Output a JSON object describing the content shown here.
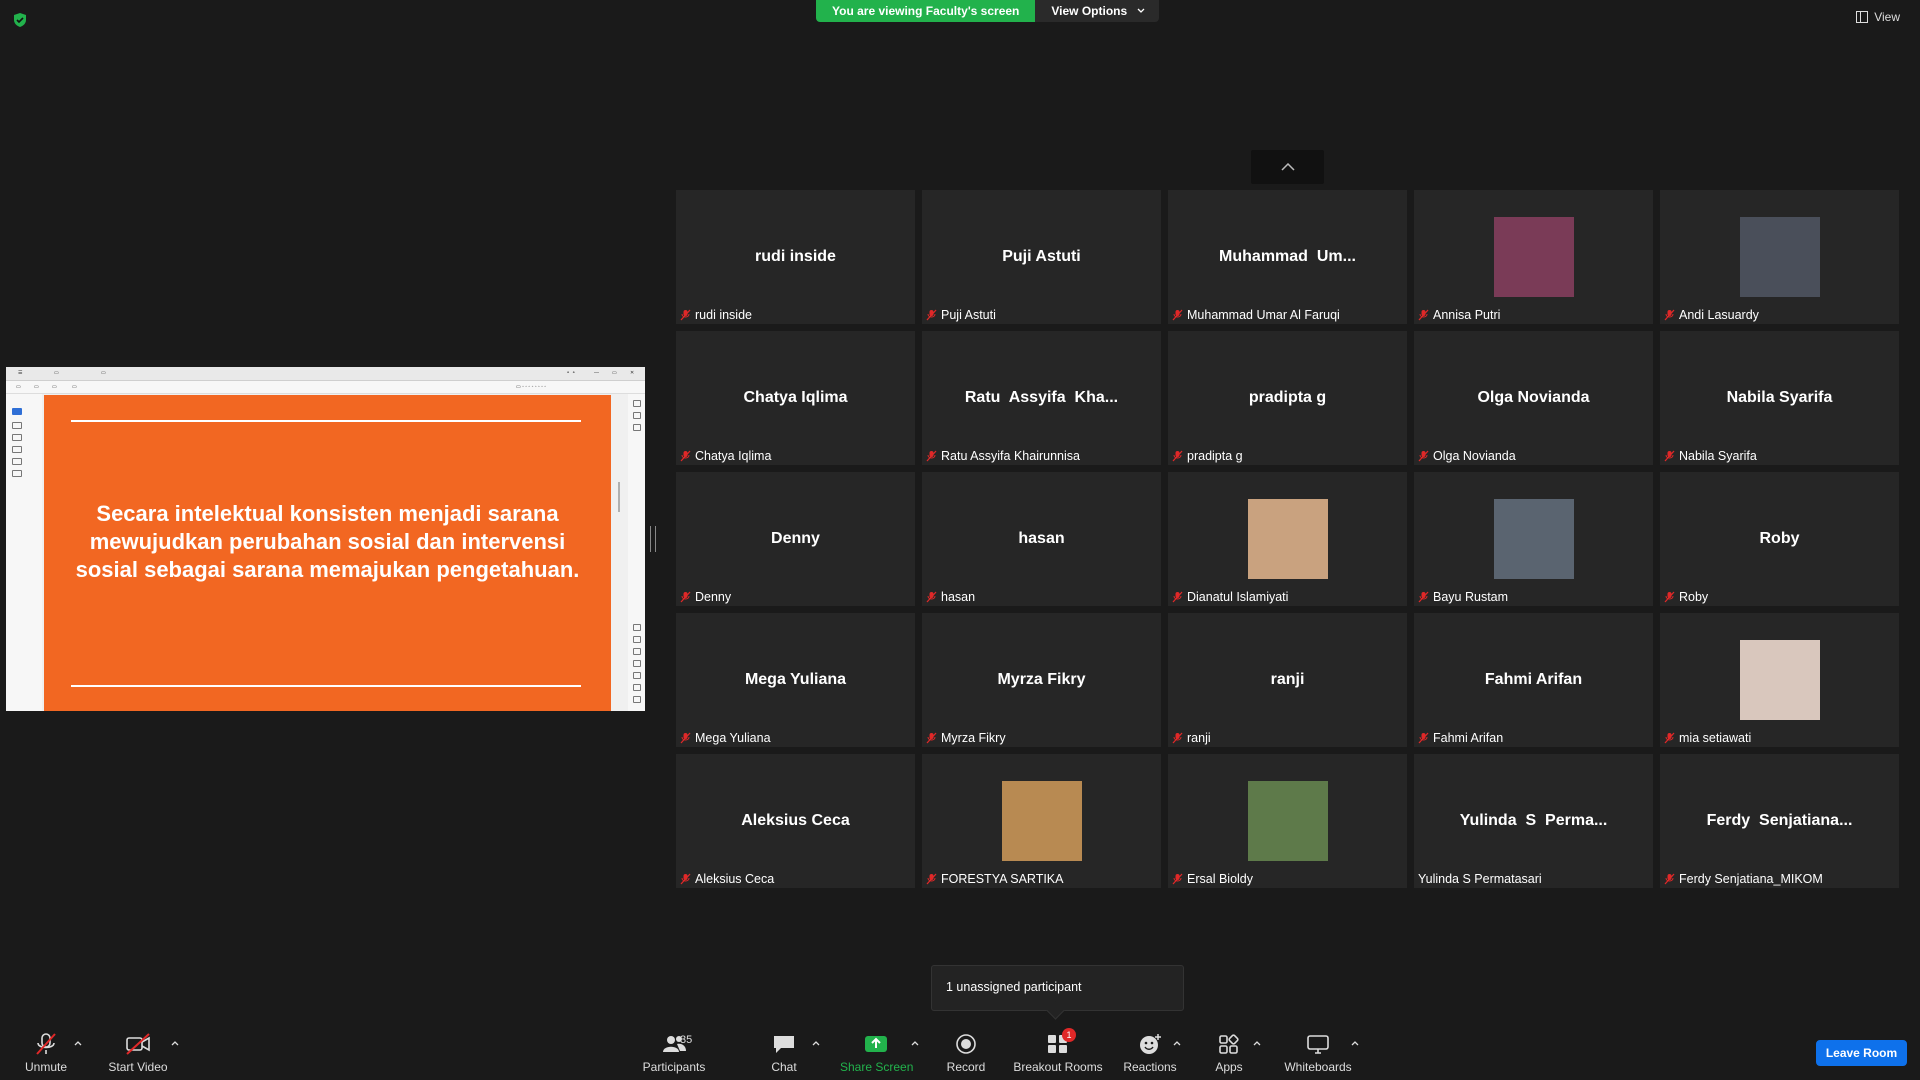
{
  "banner": {
    "viewing": "You are viewing Faculty's screen",
    "view_options": "View Options"
  },
  "top_view": {
    "label": "View"
  },
  "shared_screen": {
    "slide_text": "Secara intelektual konsisten menjadi sarana mewujudkan perubahan sosial dan intervensi sosial sebagai sarana memajukan pengetahuan.",
    "slide_color": "#f26722"
  },
  "participants": [
    {
      "display": "rudi inside",
      "name": "rudi inside",
      "muted": true,
      "photo": false
    },
    {
      "display": "Puji Astuti",
      "name": "Puji Astuti",
      "muted": true,
      "photo": false
    },
    {
      "display": "Muhammad  Um...",
      "name": "Muhammad Umar Al Faruqi",
      "muted": true,
      "photo": false
    },
    {
      "display": "",
      "name": "Annisa Putri",
      "muted": true,
      "photo": true,
      "photo_color": "#7a3b57"
    },
    {
      "display": "",
      "name": "Andi Lasuardy",
      "muted": true,
      "photo": true,
      "photo_color": "#4a4f5a"
    },
    {
      "display": "Chatya Iqlima",
      "name": "Chatya Iqlima",
      "muted": true,
      "photo": false
    },
    {
      "display": "Ratu  Assyifa  Kha...",
      "name": "Ratu Assyifa Khairunnisa",
      "muted": true,
      "photo": false
    },
    {
      "display": "pradipta g",
      "name": "pradipta g",
      "muted": true,
      "photo": false
    },
    {
      "display": "Olga Novianda",
      "name": "Olga Novianda",
      "muted": true,
      "photo": false
    },
    {
      "display": "Nabila Syarifa",
      "name": "Nabila Syarifa",
      "muted": true,
      "photo": false
    },
    {
      "display": "Denny",
      "name": "Denny",
      "muted": true,
      "photo": false
    },
    {
      "display": "hasan",
      "name": "hasan",
      "muted": true,
      "photo": false
    },
    {
      "display": "",
      "name": "Dianatul Islamiyati",
      "muted": true,
      "photo": true,
      "photo_color": "#c9a27f"
    },
    {
      "display": "",
      "name": "Bayu Rustam",
      "muted": true,
      "photo": true,
      "photo_color": "#5a6470"
    },
    {
      "display": "Roby",
      "name": "Roby",
      "muted": true,
      "photo": false
    },
    {
      "display": "Mega Yuliana",
      "name": "Mega Yuliana",
      "muted": true,
      "photo": false
    },
    {
      "display": "Myrza Fikry",
      "name": "Myrza Fikry",
      "muted": true,
      "photo": false
    },
    {
      "display": "ranji",
      "name": "ranji",
      "muted": true,
      "photo": false
    },
    {
      "display": "Fahmi Arifan",
      "name": "Fahmi Arifan",
      "muted": true,
      "photo": false
    },
    {
      "display": "",
      "name": "mia setiawati",
      "muted": true,
      "photo": true,
      "photo_color": "#d9c7bd"
    },
    {
      "display": "Aleksius Ceca",
      "name": "Aleksius Ceca",
      "muted": true,
      "photo": false
    },
    {
      "display": "",
      "name": "FORESTYA SARTIKA",
      "muted": true,
      "photo": true,
      "photo_color": "#b88a52"
    },
    {
      "display": "",
      "name": "Ersal Bioldy",
      "muted": true,
      "photo": true,
      "photo_color": "#5e7a4a"
    },
    {
      "display": "Yulinda  S  Perma...",
      "name": "Yulinda S Permatasari",
      "muted": false,
      "photo": false
    },
    {
      "display": "Ferdy  Senjatiana...",
      "name": "Ferdy Senjatiana_MIKOM",
      "muted": true,
      "photo": false
    }
  ],
  "tooltip": {
    "text": "1 unassigned participant"
  },
  "toolbar": {
    "unmute": "Unmute",
    "start_video": "Start Video",
    "participants": "Participants",
    "participants_count": "35",
    "chat": "Chat",
    "share_screen": "Share Screen",
    "record": "Record",
    "breakout_rooms": "Breakout Rooms",
    "breakout_badge": "1",
    "reactions": "Reactions",
    "apps": "Apps",
    "whiteboards": "Whiteboards",
    "leave": "Leave Room"
  },
  "colors": {
    "share_green": "#22b24c",
    "leave_blue": "#0e71eb",
    "mute_red": "#e02828"
  }
}
